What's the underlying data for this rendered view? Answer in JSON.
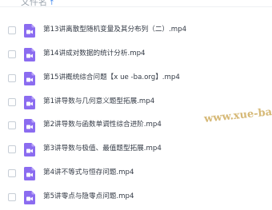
{
  "header": {
    "column_label": "文件名",
    "sort_icon": "sort-ascending-arrow-icon"
  },
  "files": [
    {
      "name": "第13讲离散型随机变量及其分布列（二）.mp4",
      "icon": "video-file-icon"
    },
    {
      "name": "第14讲成对数据的统计分析.mp4",
      "icon": "video-file-icon"
    },
    {
      "name": "第15讲概统综合问题【x ue -ba.org】.mp4",
      "icon": "video-file-icon"
    },
    {
      "name": "第1讲导数与几何意义题型拓展.mp4",
      "icon": "video-file-icon"
    },
    {
      "name": "第2讲导数与函数单调性综合进阶.mp4",
      "icon": "video-file-icon"
    },
    {
      "name": "第3讲导数与极值、最值题型拓展.mp4",
      "icon": "video-file-icon"
    },
    {
      "name": "第4讲不等式与恒存问题.mp4",
      "icon": "video-file-icon"
    },
    {
      "name": "第5讲零点与隐零点问题.mp4",
      "icon": "video-file-icon"
    }
  ],
  "watermark": "www.xue-ba.org",
  "colors": {
    "icon_purple": "#8b6cf0",
    "text": "#333a45",
    "accent_blue": "#4a8ef0",
    "watermark_gold": "#c9a24a"
  }
}
